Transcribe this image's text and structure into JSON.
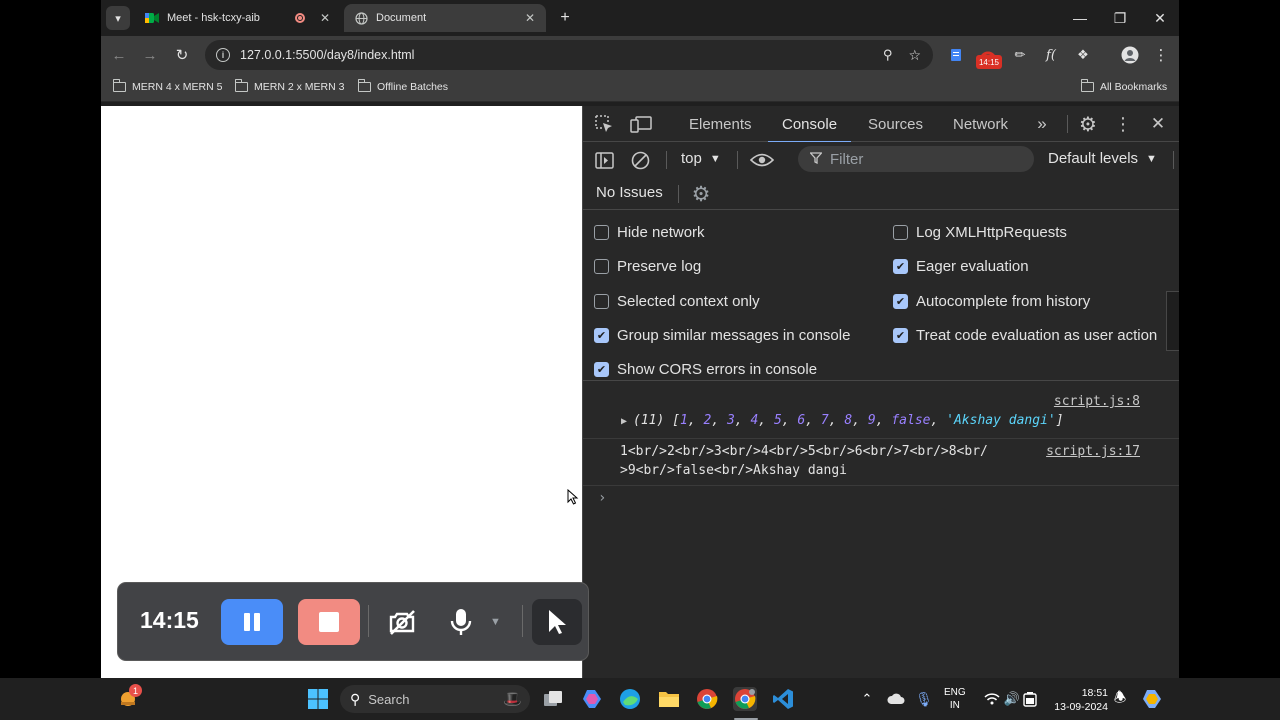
{
  "browser": {
    "tabs": [
      {
        "title": "Meet - hsk-tcxy-aib"
      },
      {
        "title": "Document"
      }
    ],
    "url": "127.0.0.1:5500/day8/index.html",
    "extension_badge": "14:15",
    "bookmarks": [
      "MERN 4 x MERN 5",
      "MERN 2 x MERN 3",
      "Offline Batches"
    ],
    "all_bookmarks": "All Bookmarks"
  },
  "devtools": {
    "tabs": [
      "Elements",
      "Console",
      "Sources",
      "Network"
    ],
    "active_tab": "Console",
    "context": "top",
    "filter_placeholder": "Filter",
    "levels": "Default levels",
    "issues": "No Issues",
    "options_left": [
      {
        "label": "Hide network",
        "checked": false
      },
      {
        "label": "Preserve log",
        "checked": false
      },
      {
        "label": "Selected context only",
        "checked": false
      },
      {
        "label": "Group similar messages in console",
        "checked": true
      },
      {
        "label": "Show CORS errors in console",
        "checked": true
      }
    ],
    "options_right": [
      {
        "label": "Log XMLHttpRequests",
        "checked": false
      },
      {
        "label": "Eager evaluation",
        "checked": true
      },
      {
        "label": "Autocomplete from history",
        "checked": true
      },
      {
        "label": "Treat code evaluation as user action",
        "checked": true
      }
    ],
    "console": {
      "msg1_source": "script.js:8",
      "msg1_count": "(11)",
      "msg1_items": [
        "1",
        "2",
        "3",
        "4",
        "5",
        "6",
        "7",
        "8",
        "9",
        "false",
        "'Akshay dangi'"
      ],
      "msg2_source": "script.js:17",
      "msg2_line1": "1<br/>2<br/>3<br/>4<br/>5<br/>6<br/>7<br/>8<br/",
      "msg2_line2": ">9<br/>false<br/>Akshay dangi"
    }
  },
  "recorder": {
    "time": "14:15"
  },
  "taskbar": {
    "search": "Search",
    "lang1": "ENG",
    "lang2": "IN",
    "time": "18:51",
    "date": "13-09-2024",
    "notif": "1"
  }
}
